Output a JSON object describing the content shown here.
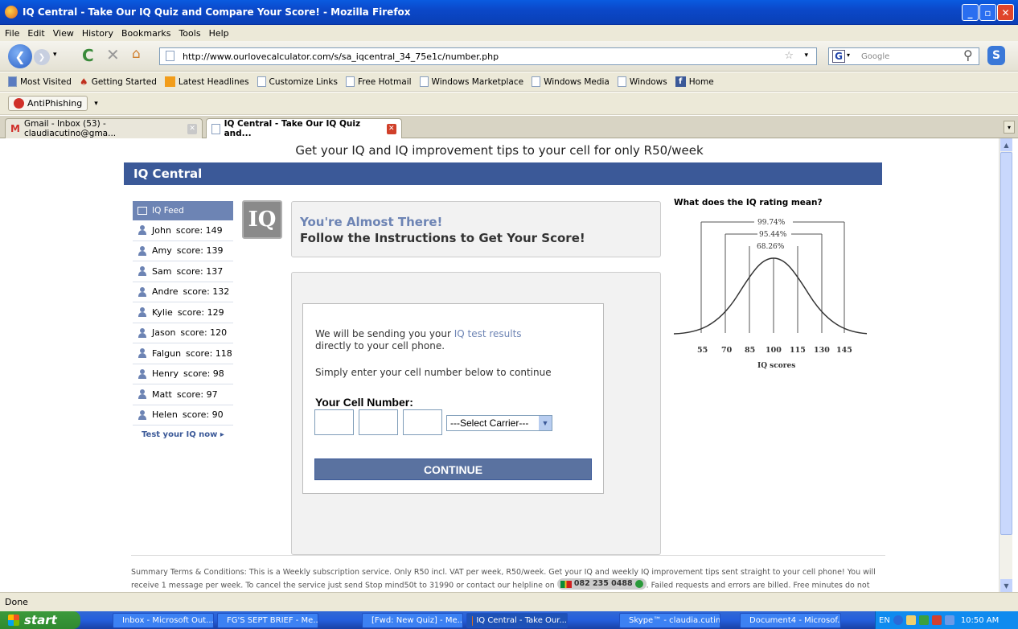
{
  "window": {
    "title": "IQ Central - Take Our IQ Quiz and Compare Your Score! - Mozilla Firefox"
  },
  "menu": [
    "File",
    "Edit",
    "View",
    "History",
    "Bookmarks",
    "Tools",
    "Help"
  ],
  "nav": {
    "url": "http://www.ourlovecalculator.com/s/sa_iqcentral_34_75e1c/number.php",
    "search_placeholder": "Google"
  },
  "bookmarks": [
    "Most Visited",
    "Getting Started",
    "Latest Headlines",
    "Customize Links",
    "Free Hotmail",
    "Windows Marketplace",
    "Windows Media",
    "Windows",
    "Home"
  ],
  "toolbar": {
    "antiphishing": "AntiPhishing"
  },
  "tabs": [
    {
      "label": "Gmail - Inbox (53) - claudiacutino@gma..."
    },
    {
      "label": "IQ Central - Take Our IQ Quiz and..."
    }
  ],
  "page": {
    "banner": "Get your IQ and IQ improvement tips to your cell for only R50/week",
    "header": "IQ Central",
    "feed_title": "IQ Feed",
    "feed": [
      {
        "name": "John",
        "score": "score: 149"
      },
      {
        "name": "Amy",
        "score": "score: 139"
      },
      {
        "name": "Sam",
        "score": "score: 137"
      },
      {
        "name": "Andre",
        "score": "score: 132"
      },
      {
        "name": "Kylie",
        "score": "score: 129"
      },
      {
        "name": "Jason",
        "score": "score: 120"
      },
      {
        "name": "Falgun",
        "score": "score: 118"
      },
      {
        "name": "Henry",
        "score": "score: 98"
      },
      {
        "name": "Matt",
        "score": "score: 97"
      },
      {
        "name": "Helen",
        "score": "score: 90"
      }
    ],
    "test_link": "Test your IQ now",
    "badge": "IQ",
    "almost_title": "You're Almost There!",
    "almost_sub": "Follow the Instructions to Get Your Score!",
    "send_pre": "We will be sending you your ",
    "send_link": "IQ test results",
    "send_post": "directly to your cell phone.",
    "simply": "Simply enter your cell number below to continue",
    "cell_label": "Your Cell Number:",
    "carrier_default": "---Select Carrier---",
    "continue": "CONTINUE",
    "chart_title": "What does the IQ rating mean?",
    "chart_ranges": [
      "99.74%",
      "95.44%",
      "68.26%"
    ],
    "chart_ticks": [
      "55",
      "70",
      "85",
      "100",
      "115",
      "130",
      "145"
    ],
    "chart_xlabel": "IQ scores",
    "footer_text": "Summary Terms & Conditions: This is a Weekly subscription service. Only R50 incl. VAT per week, R50/week. Get your IQ and weekly IQ improvement tips sent straight to your cell phone! You will receive 1 message per week. To cancel the service just send Stop mind50t to 31990 or contact our helpline on",
    "helpline": "082 235 0488",
    "footer_tail": ". Failed requests and errors are billed. Free minutes do not apply."
  },
  "status": "Done",
  "taskbar": {
    "start": "start",
    "tasks": [
      "Inbox - Microsoft Out...",
      "FG'S SEPT BRIEF - Me...",
      "[Fwd: New Quiz] - Me...",
      "IQ Central - Take Our...",
      "Skype™ - claudia.cutino",
      "Document4 - Microsof..."
    ],
    "lang": "EN",
    "clock": "10:50 AM"
  }
}
